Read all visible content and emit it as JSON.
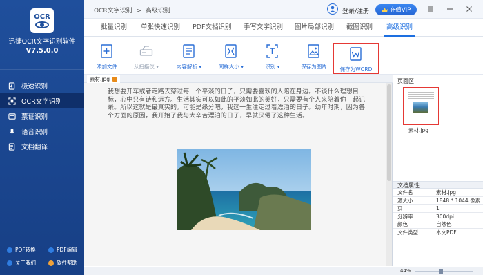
{
  "app": {
    "logo_text": "OCR",
    "name": "迅捷OCR文字识别软件",
    "version": "V7.5.0.0"
  },
  "sidebar": {
    "items": [
      {
        "label": "极速识别",
        "icon": "lightning-doc-icon"
      },
      {
        "label": "OCR文字识别",
        "icon": "ocr-icon"
      },
      {
        "label": "票证识别",
        "icon": "ticket-icon"
      },
      {
        "label": "语音识别",
        "icon": "microphone-icon"
      },
      {
        "label": "文档翻译",
        "icon": "translate-icon"
      }
    ],
    "active_index": 1,
    "footer": [
      {
        "label": "PDF转换",
        "icon": "pdf-convert-icon",
        "color": "#2f7de1"
      },
      {
        "label": "PDF编辑",
        "icon": "pdf-edit-icon",
        "color": "#2f7de1"
      },
      {
        "label": "关于我们",
        "icon": "about-icon",
        "color": "#2f7de1"
      },
      {
        "label": "软件帮助",
        "icon": "help-icon",
        "color": "#f0a23a"
      }
    ]
  },
  "header": {
    "breadcrumb": [
      "OCR文字识别",
      ">",
      "高级识别"
    ],
    "login_label": "登录/注册",
    "vip_label": "充值VIP"
  },
  "tabs": [
    {
      "label": "批量识别"
    },
    {
      "label": "单张快速识别"
    },
    {
      "label": "PDF文档识别"
    },
    {
      "label": "手写文字识别"
    },
    {
      "label": "图片局部识别"
    },
    {
      "label": "截图识别"
    },
    {
      "label": "高级识别"
    }
  ],
  "active_tab": 6,
  "toolbar": {
    "tools": [
      {
        "label": "添加文件",
        "icon": "add-file-icon",
        "disabled": false
      },
      {
        "label": "从扫描仪 ▾",
        "icon": "scanner-icon",
        "disabled": true
      },
      {
        "label": "内容解析 ▾",
        "icon": "content-parse-icon",
        "disabled": false
      },
      {
        "label": "同样大小 ▾",
        "icon": "same-size-icon",
        "disabled": false
      },
      {
        "label": "识别 ▾",
        "icon": "recognize-icon",
        "disabled": false
      },
      {
        "label": "保存为图片",
        "icon": "save-image-icon",
        "disabled": false
      },
      {
        "label": "保存为WORD",
        "icon": "save-word-icon",
        "disabled": false
      }
    ],
    "highlighted_tool": 6
  },
  "document": {
    "tab_label": "素材.jpg",
    "text": "我想要开车或者走路去穿过每一个平淡的日子，只需要喜欢的人陪在身边。不谈什么理想目标，心中只有诗和远方。生活其实可以如此的平淡如此的美好，只需要有个人来陪着你一起记录。所以这就是最真实的。可能是缘分吧，我这一生注定过着漂泊的日子。幼年时期，因为各个方面的原因，我开始了我与大辛苦漂泊的日子，早就厌倦了这种生活。"
  },
  "page_area": {
    "title": "页面区",
    "thumb_label": "素材.jpg"
  },
  "properties": {
    "title": "文档属性",
    "rows": [
      {
        "key": "文件名",
        "value": "素材.jpg"
      },
      {
        "key": "源大小",
        "value": "1848 * 1044 像素"
      },
      {
        "key": "页",
        "value": "1"
      },
      {
        "key": "分辨率",
        "value": "300dpi"
      },
      {
        "key": "颜色",
        "value": "自然色"
      },
      {
        "key": "文件类型",
        "value": "本文PDF"
      }
    ]
  },
  "status": {
    "zoom": "44%"
  },
  "colors": {
    "sidebar": "#1f4f9c",
    "accent": "#1d6fe0",
    "highlight_border": "#e53935"
  }
}
